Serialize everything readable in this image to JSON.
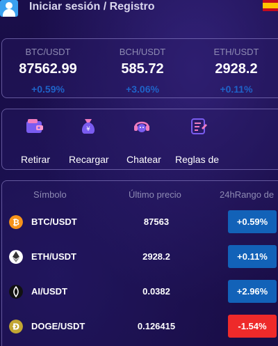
{
  "header": {
    "login_label": "Iniciar sesión / Registro",
    "icons": {
      "avatar": "user-avatar-icon",
      "language": "spain-flag-icon"
    }
  },
  "tickers": [
    {
      "pair": "BTC/USDT",
      "price": "87562.99",
      "change": "+0.59%"
    },
    {
      "pair": "BCH/USDT",
      "price": "585.72",
      "change": "+3.06%"
    },
    {
      "pair": "ETH/USDT",
      "price": "2928.2",
      "change": "+0.11%"
    }
  ],
  "actions": [
    {
      "label": "Retirar",
      "icon": "wallet-icon"
    },
    {
      "label": "Recargar",
      "icon": "money-bag-icon"
    },
    {
      "label": "Chatear",
      "icon": "headset-icon"
    },
    {
      "label": "Reglas de",
      "icon": "rules-list-icon"
    }
  ],
  "market": {
    "columns": [
      "Símbolo",
      "Último precio",
      "24hRango de"
    ],
    "rows": [
      {
        "symbol": "BTC/USDT",
        "price": "87563",
        "change": "+0.59%",
        "trend": "up",
        "icon": "bitcoin-icon"
      },
      {
        "symbol": "ETH/USDT",
        "price": "2928.2",
        "change": "+0.11%",
        "trend": "up",
        "icon": "ethereum-icon"
      },
      {
        "symbol": "AI/USDT",
        "price": "0.0382",
        "change": "+2.96%",
        "trend": "up",
        "icon": "ai-token-icon"
      },
      {
        "symbol": "DOGE/USDT",
        "price": "0.126415",
        "change": "-1.54%",
        "trend": "down",
        "icon": "dogecoin-icon"
      }
    ]
  },
  "colors": {
    "background": "#140a3c",
    "positive": "#1262b8",
    "negative": "#ee2a2a",
    "muted_text": "#8e8bb3"
  }
}
